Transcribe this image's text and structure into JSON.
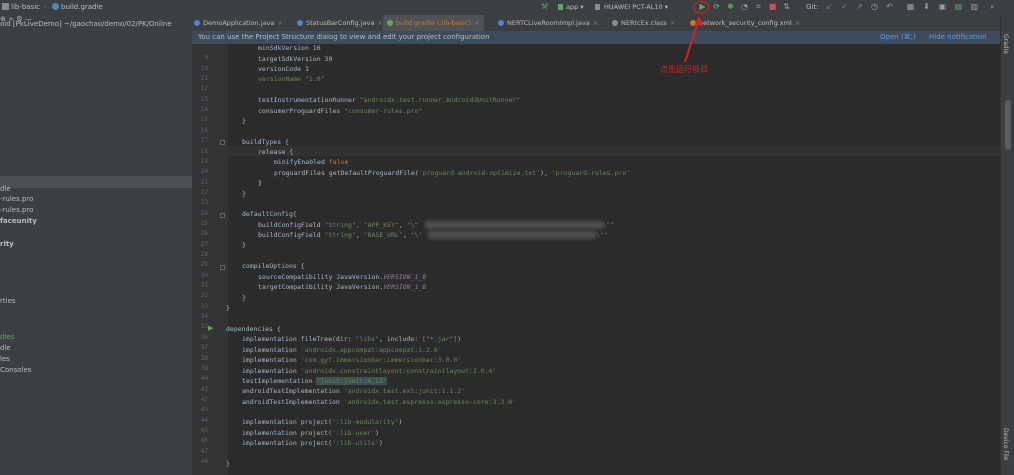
{
  "nav": {
    "breadcrumb_module": "lib-basic",
    "breadcrumb_file": "build.gradle",
    "run_config": "app",
    "device": "HUAWEI PCT-AL10",
    "git_label": "Git:"
  },
  "tabs": [
    {
      "label": "DemoApplication.java",
      "active": false
    },
    {
      "label": "StatusBarConfig.java",
      "active": false
    },
    {
      "label": "build.gradle (:lib-basic)",
      "active": true
    },
    {
      "label": "NERTCLiveRoomImpl.java",
      "active": false
    },
    {
      "label": "NERtcEx.class",
      "active": false
    },
    {
      "label": "network_security_config.xml",
      "active": false
    }
  ],
  "project": {
    "title": "oid [PkLiveDemo] ~/gaochao/demo/02/PK/Online"
  },
  "notification": {
    "text": "You can use the Project Structure dialog to view and edit your project configuration",
    "open_link": "Open (⌘;)",
    "hide_link": "Hide notification"
  },
  "tree_fragments": [
    "dle",
    "-rules.pro",
    "-rules.pro",
    "faceunity",
    "rity",
    "rties",
    "dles",
    "dle",
    "les",
    "Consoles"
  ],
  "line_numbers": [
    "",
    "9",
    "10",
    "11",
    "12",
    "13",
    "14",
    "15",
    "16",
    "17",
    "18",
    "19",
    "20",
    "21",
    "22",
    "23",
    "24",
    "25",
    "26",
    "27",
    "28",
    "29",
    "30",
    "31",
    "32",
    "33",
    "34",
    "35",
    "36",
    "37",
    "38",
    "39",
    "40",
    "41",
    "42",
    "43",
    "44",
    "45",
    "46",
    "47",
    "48"
  ],
  "code": {
    "l0": "minSdkVersion 16",
    "l1": "targetSdkVersion 30",
    "l2": "versionCode 1",
    "l3": "versionName \"1.0\"",
    "l5_a": "testInstrumentationRunner ",
    "l5_b": "\"androidx.test.runner.AndroidJUnitRunner\"",
    "l6_a": "consumerProguardFiles ",
    "l6_b": "\"consumer-rules.pro\"",
    "l7": "}",
    "l9": "buildTypes {",
    "l10": "release {",
    "l11_a": "minifyEnabled ",
    "l11_b": "false",
    "l12_a": "proguardFiles getDefaultProguardFile(",
    "l12_b": "'proguard-android-optimize.txt'",
    "l12_c": "), ",
    "l12_d": "'proguard-rules.pro'",
    "l13": "}",
    "l14": "}",
    "l16": "defaultConfig{",
    "l17_a": "buildConfigField ",
    "l17_b": "\"String\"",
    "l17_c": ", ",
    "l17_d": "\"APP_KEY\"",
    "l17_e": ", ",
    "l17_f": "\"\\\"",
    "l17_g": "3\\\"\"",
    "l18_a": "buildConfigField ",
    "l18_b": "\"String\"",
    "l18_c": ", ",
    "l18_d": "\"BASE_URL\"",
    "l18_e": ", ",
    "l18_f": "\"\\\"",
    "l18_g": "/\\\"\"",
    "l19": "}",
    "l21": "compileOptions {",
    "l22_a": "sourceCompatibility JavaVersion.",
    "l22_b": "VERSION_1_8",
    "l23_a": "targetCompatibility JavaVersion.",
    "l23_b": "VERSION_1_8",
    "l24": "}",
    "l25": "}",
    "l27": "dependencies {",
    "l28_a": "implementation fileTree(",
    "l28_b": "dir: ",
    "l28_c": "\"libs\"",
    "l28_d": ", ",
    "l28_e": "include: ",
    "l28_f": "[\"*.jar\"]",
    "l28_g": ")",
    "l29_a": "implementation ",
    "l29_b": "'androidx.appcompat:appcompat:1.2.0'",
    "l30_a": "implementation ",
    "l30_b": "'com.gyf.immersionbar:immersionbar:3.0.0'",
    "l31_a": "implementation ",
    "l31_b": "'androidx.constraintlayout:constraintlayout:2.0.4'",
    "l32_a": "testImplementation ",
    "l32_b": "'junit:junit:4.12'",
    "l33_a": "androidTestImplementation ",
    "l33_b": "'androidx.test.ext:junit:1.1.2'",
    "l34_a": "androidTestImplementation ",
    "l34_b": "'androidx.test.espresso:espresso-core:3.3.0'",
    "l36_a": "implementation project(",
    "l36_b": "':lib-modularity'",
    "l36_c": ")",
    "l37_a": "implementation project(",
    "l37_b": "':lib-user'",
    "l37_c": ")",
    "l38_a": "implementation project(",
    "l38_b": "':lib-utils'",
    "l38_c": ")",
    "l40": "}"
  },
  "annotation": {
    "text": "点击运行项目",
    "color": "#e0201c"
  },
  "right_strip": {
    "top_label": "Gradle",
    "bottom_label": "Device File"
  },
  "colors": {
    "keyword": "#cc7832",
    "string": "#6a8759",
    "number": "#6897bb",
    "constant": "#9876aa",
    "run_green": "#59a869"
  }
}
